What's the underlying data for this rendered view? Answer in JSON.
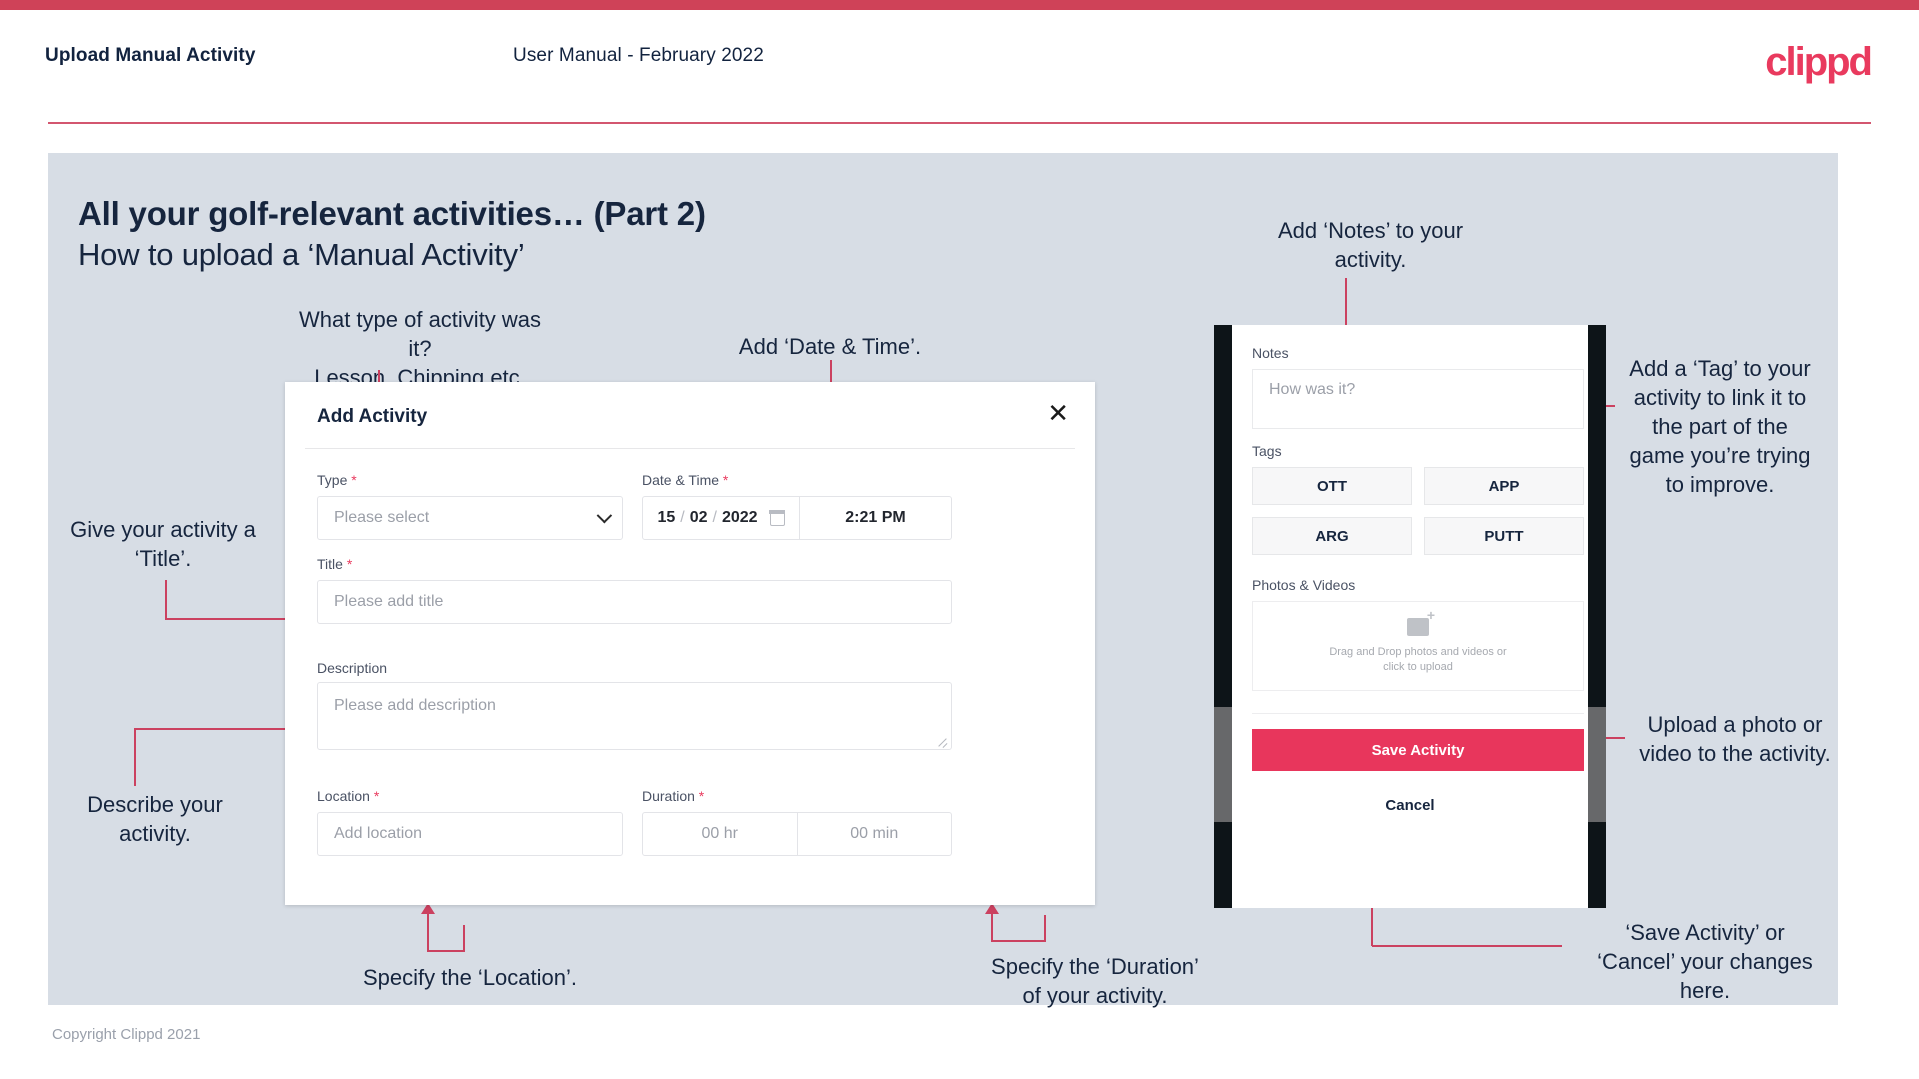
{
  "header": {
    "title": "Upload Manual Activity",
    "subtitle": "User Manual - February 2022",
    "logo": "clippd"
  },
  "slide": {
    "title": "All your golf-relevant activities… (Part 2)",
    "subtitle": "How to upload a ‘Manual Activity’",
    "copyright": "Copyright Clippd 2021"
  },
  "colors": {
    "brand_red": "#e93a5e",
    "accent_line": "#cb4160",
    "slide_bg": "#d7dde5",
    "title_navy": "#16253e",
    "save_button": "#e8365c"
  },
  "dialog": {
    "title": "Add Activity",
    "close_icon": "close-icon",
    "fields": {
      "type": {
        "label": "Type",
        "required": true,
        "placeholder": "Please select",
        "icon": "chevron-down-icon"
      },
      "datetime": {
        "label": "Date & Time",
        "required": true,
        "day": "15",
        "month": "02",
        "year": "2022",
        "separator": "/",
        "calendar_icon": "calendar-icon",
        "time": "2:21 PM"
      },
      "title": {
        "label": "Title",
        "required": true,
        "placeholder": "Please add title"
      },
      "description": {
        "label": "Description",
        "required": false,
        "placeholder": "Please add description"
      },
      "location": {
        "label": "Location",
        "required": true,
        "placeholder": "Add location"
      },
      "duration": {
        "label": "Duration",
        "required": true,
        "hours": "00 hr",
        "minutes": "00 min"
      }
    }
  },
  "phone": {
    "notes": {
      "label": "Notes",
      "placeholder": "How was it?"
    },
    "tags": {
      "label": "Tags",
      "items": [
        "OTT",
        "APP",
        "ARG",
        "PUTT"
      ]
    },
    "photos": {
      "label": "Photos & Videos",
      "icon": "add-image-icon",
      "line1": "Drag and Drop photos and videos or",
      "line2": "click to upload"
    },
    "save_label": "Save Activity",
    "cancel_label": "Cancel"
  },
  "annotations": {
    "type": "What type of activity was it?\nLesson, Chipping etc.",
    "datetime": "Add ‘Date & Time’.",
    "title": "Give your activity a\n‘Title’.",
    "description": "Describe your\nactivity.",
    "location": "Specify the ‘Location’.",
    "duration": "Specify the ‘Duration’\nof your activity.",
    "notes": "Add ‘Notes’ to your\nactivity.",
    "tags": "Add a ‘Tag’ to your\nactivity to link it to\nthe part of the\ngame you’re trying\nto improve.",
    "photos": "Upload a photo or\nvideo to the activity.",
    "save_cancel": "‘Save Activity’ or\n‘Cancel’ your changes\nhere."
  }
}
